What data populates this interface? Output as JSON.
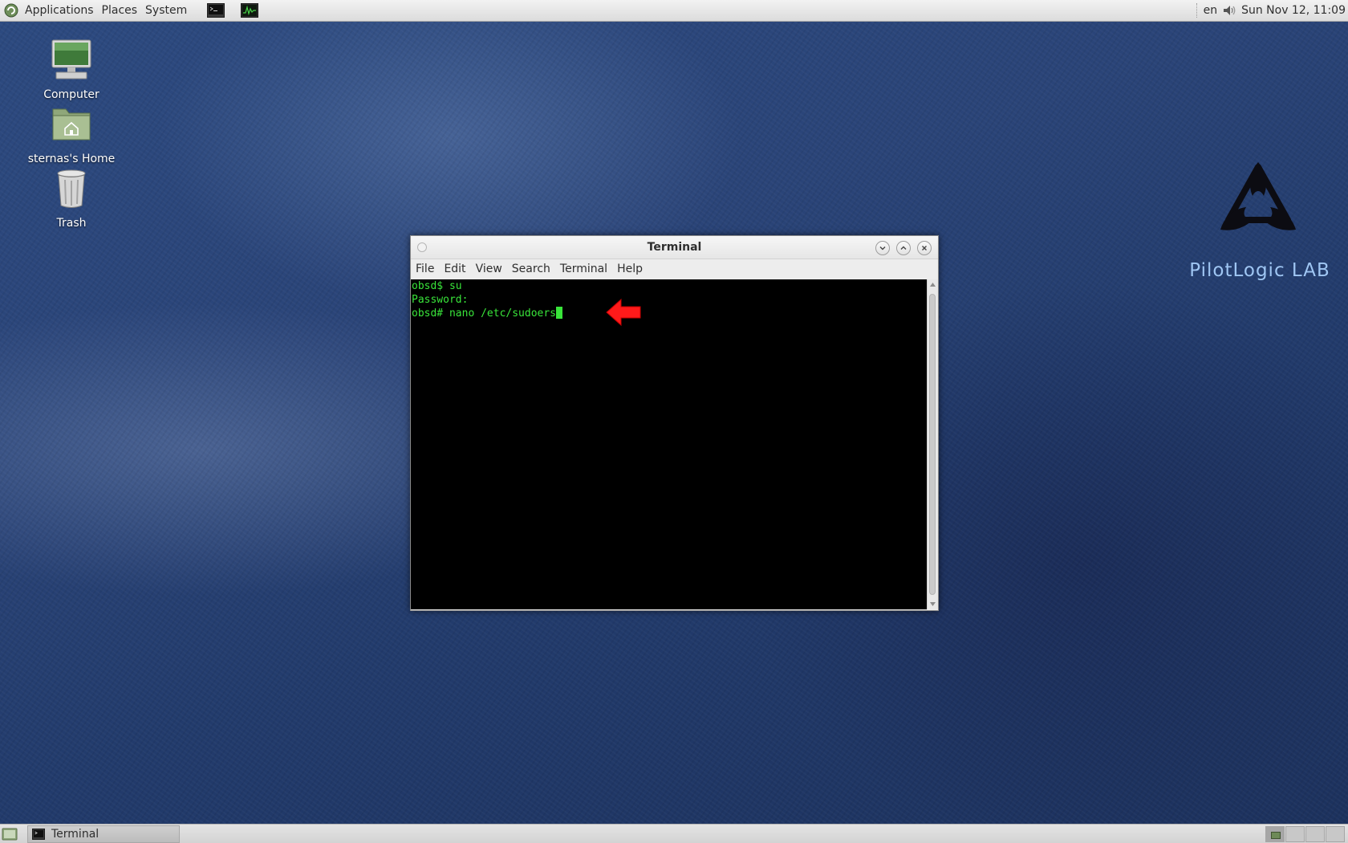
{
  "top_panel": {
    "menus": [
      "Applications",
      "Places",
      "System"
    ],
    "launchers": [
      "terminal-icon",
      "system-monitor-icon"
    ],
    "language": "en",
    "clock": "Sun Nov 12, 11:09"
  },
  "desktop_icons": [
    {
      "label": "Computer",
      "icon": "computer-icon"
    },
    {
      "label": "sternas's Home",
      "icon": "home-folder-icon"
    },
    {
      "label": "Trash",
      "icon": "trash-icon"
    }
  ],
  "brand": {
    "text": "PilotLogic LAB"
  },
  "terminal": {
    "title": "Terminal",
    "menu": [
      "File",
      "Edit",
      "View",
      "Search",
      "Terminal",
      "Help"
    ],
    "lines": [
      "obsd$ su",
      "Password:",
      "obsd# nano /etc/sudoers"
    ],
    "text_color": "#39e53a",
    "background": "#000000",
    "annotation_arrow_color": "#ff1a1a"
  },
  "taskbar": {
    "items": [
      {
        "label": "Terminal",
        "icon": "terminal-icon"
      }
    ],
    "workspaces": 4,
    "active_workspace": 1
  }
}
